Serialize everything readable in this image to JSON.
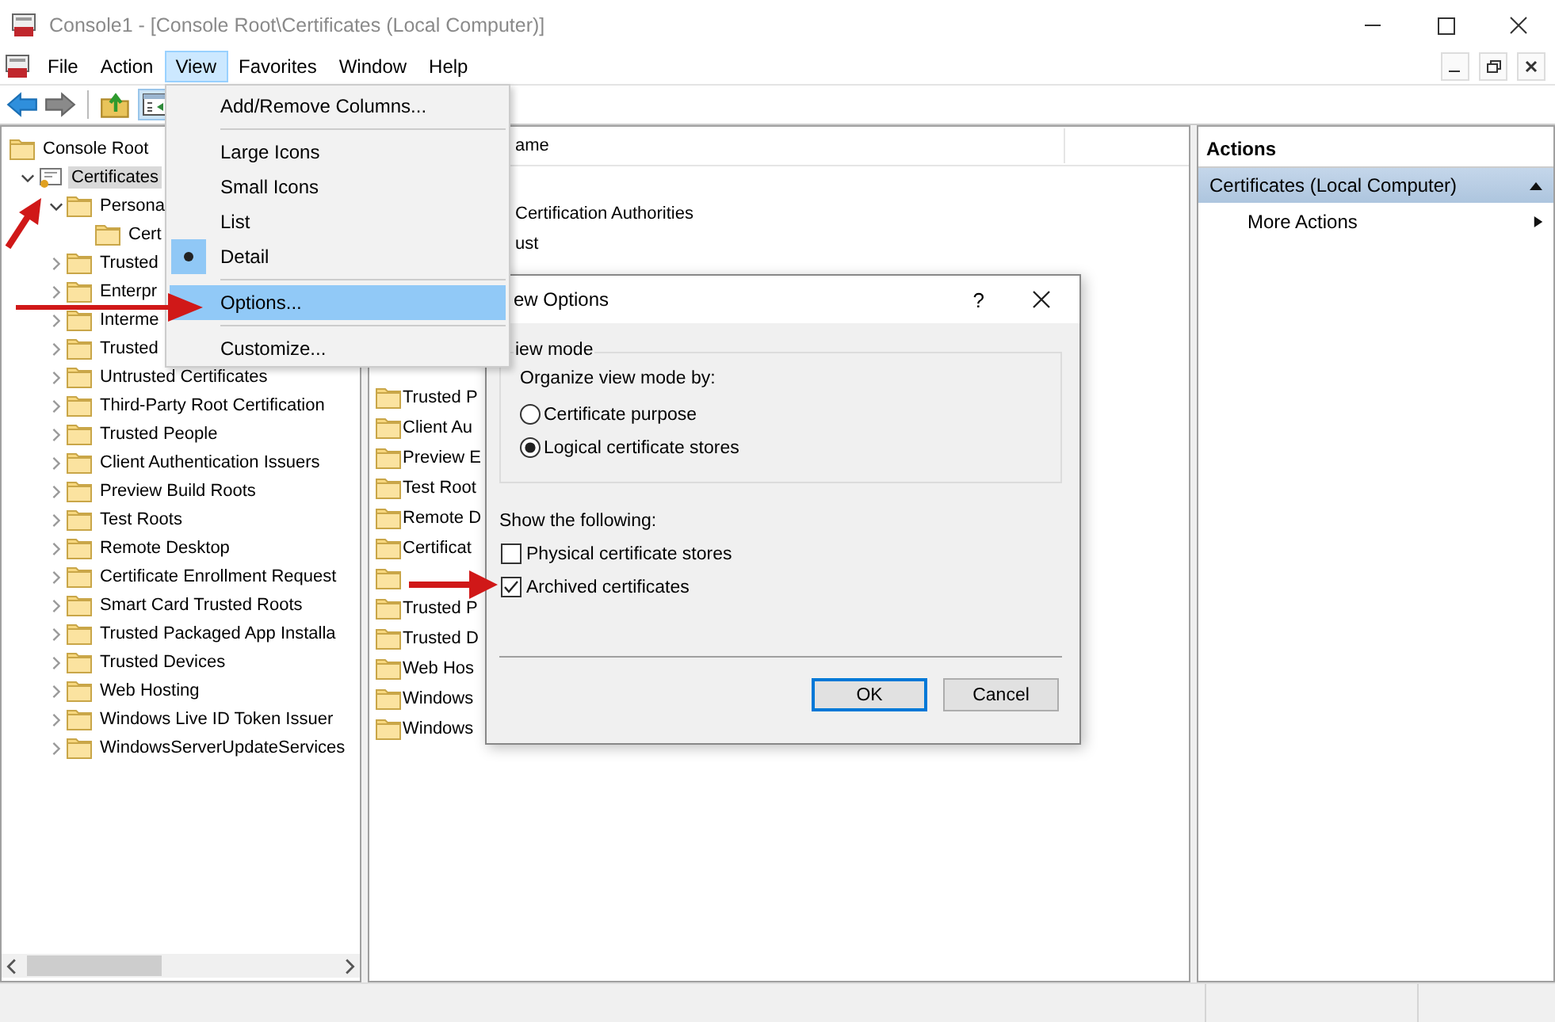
{
  "window": {
    "title": "Console1 - [Console Root\\Certificates (Local Computer)]"
  },
  "menu_bar": [
    {
      "label": "File",
      "selected": false
    },
    {
      "label": "Action",
      "selected": false
    },
    {
      "label": "View",
      "selected": true
    },
    {
      "label": "Favorites",
      "selected": false
    },
    {
      "label": "Window",
      "selected": false
    },
    {
      "label": "Help",
      "selected": false
    }
  ],
  "tree": [
    {
      "label": "Console Root",
      "kind": "folder",
      "selected": false,
      "children": [
        {
          "label": "Certificates",
          "kind": "snapin",
          "expanded": true,
          "selected": true,
          "children": [
            {
              "label": "Persona",
              "kind": "folder",
              "expanded": true,
              "selected": false,
              "children": [
                {
                  "label": "Cert",
                  "kind": "folder",
                  "selected": false
                }
              ]
            },
            {
              "label": "Trusted",
              "kind": "folder",
              "expanded": false,
              "selected": false
            },
            {
              "label": "Enterpr",
              "kind": "folder",
              "expanded": false,
              "selected": false
            },
            {
              "label": "Interme",
              "kind": "folder",
              "expanded": false,
              "selected": false
            },
            {
              "label": "Trusted",
              "kind": "folder",
              "expanded": false,
              "selected": false
            },
            {
              "label": "Untrusted Certificates",
              "kind": "folder",
              "expanded": false,
              "selected": false
            },
            {
              "label": "Third-Party Root Certification",
              "kind": "folder",
              "expanded": false,
              "selected": false
            },
            {
              "label": "Trusted People",
              "kind": "folder",
              "expanded": false,
              "selected": false
            },
            {
              "label": "Client Authentication Issuers",
              "kind": "folder",
              "expanded": false,
              "selected": false
            },
            {
              "label": "Preview Build Roots",
              "kind": "folder",
              "expanded": false,
              "selected": false
            },
            {
              "label": "Test Roots",
              "kind": "folder",
              "expanded": false,
              "selected": false
            },
            {
              "label": "Remote Desktop",
              "kind": "folder",
              "expanded": false,
              "selected": false
            },
            {
              "label": "Certificate Enrollment Request",
              "kind": "folder",
              "expanded": false,
              "selected": false
            },
            {
              "label": "Smart Card Trusted Roots",
              "kind": "folder",
              "expanded": false,
              "selected": false
            },
            {
              "label": "Trusted Packaged App Installa",
              "kind": "folder",
              "expanded": false,
              "selected": false
            },
            {
              "label": "Trusted Devices",
              "kind": "folder",
              "expanded": false,
              "selected": false
            },
            {
              "label": "Web Hosting",
              "kind": "folder",
              "expanded": false,
              "selected": false
            },
            {
              "label": "Windows Live ID Token Issuer",
              "kind": "folder",
              "expanded": false,
              "selected": false
            },
            {
              "label": "WindowsServerUpdateServices",
              "kind": "folder",
              "expanded": false,
              "selected": false
            }
          ]
        }
      ]
    }
  ],
  "list": {
    "header": "ame",
    "partial_rows": [
      "Certification Authorities",
      "ust"
    ],
    "rows": [
      {
        "kind": "item",
        "label": "Trusted P"
      },
      {
        "kind": "item",
        "label": "Client Au"
      },
      {
        "kind": "item",
        "label": "Preview E"
      },
      {
        "kind": "item",
        "label": "Test Root"
      },
      {
        "kind": "item",
        "label": "Remote D"
      },
      {
        "kind": "item",
        "label": "Certificat"
      },
      {
        "kind": "icon_only"
      },
      {
        "kind": "item",
        "label": "Trusted P"
      },
      {
        "kind": "item",
        "label": "Trusted D"
      },
      {
        "kind": "item",
        "label": "Web Hos"
      },
      {
        "kind": "item",
        "label": "Windows"
      },
      {
        "kind": "item",
        "label": "Windows"
      }
    ]
  },
  "actions": {
    "title": "Actions",
    "section": "Certificates (Local Computer)",
    "items": [
      "More Actions"
    ]
  },
  "view_menu": [
    {
      "kind": "item",
      "label": "Add/Remove Columns...",
      "selected": false,
      "highlighted": false
    },
    {
      "kind": "separator"
    },
    {
      "kind": "item",
      "label": "Large Icons",
      "selected": false,
      "highlighted": false
    },
    {
      "kind": "item",
      "label": "Small Icons",
      "selected": false,
      "highlighted": false
    },
    {
      "kind": "item",
      "label": "List",
      "selected": false,
      "highlighted": false
    },
    {
      "kind": "item",
      "label": "Detail",
      "selected": true,
      "highlighted": false
    },
    {
      "kind": "separator"
    },
    {
      "kind": "item",
      "label": "Options...",
      "selected": false,
      "highlighted": true
    },
    {
      "kind": "separator"
    },
    {
      "kind": "item",
      "label": "Customize...",
      "selected": false,
      "highlighted": false
    }
  ],
  "dialog": {
    "title": "ew Options",
    "help": "?",
    "group": "iew mode",
    "prompt": "Organize view mode by:",
    "radios": [
      {
        "label": "Certificate purpose",
        "selected": false
      },
      {
        "label": "Logical certificate stores",
        "selected": true
      }
    ],
    "show_label": "Show the following:",
    "checkboxes": [
      {
        "label": "Physical certificate stores",
        "checked": false
      },
      {
        "label": "Archived certificates",
        "checked": true
      }
    ],
    "buttons": [
      {
        "label": "OK",
        "default": true
      },
      {
        "label": "Cancel",
        "default": false
      }
    ]
  }
}
